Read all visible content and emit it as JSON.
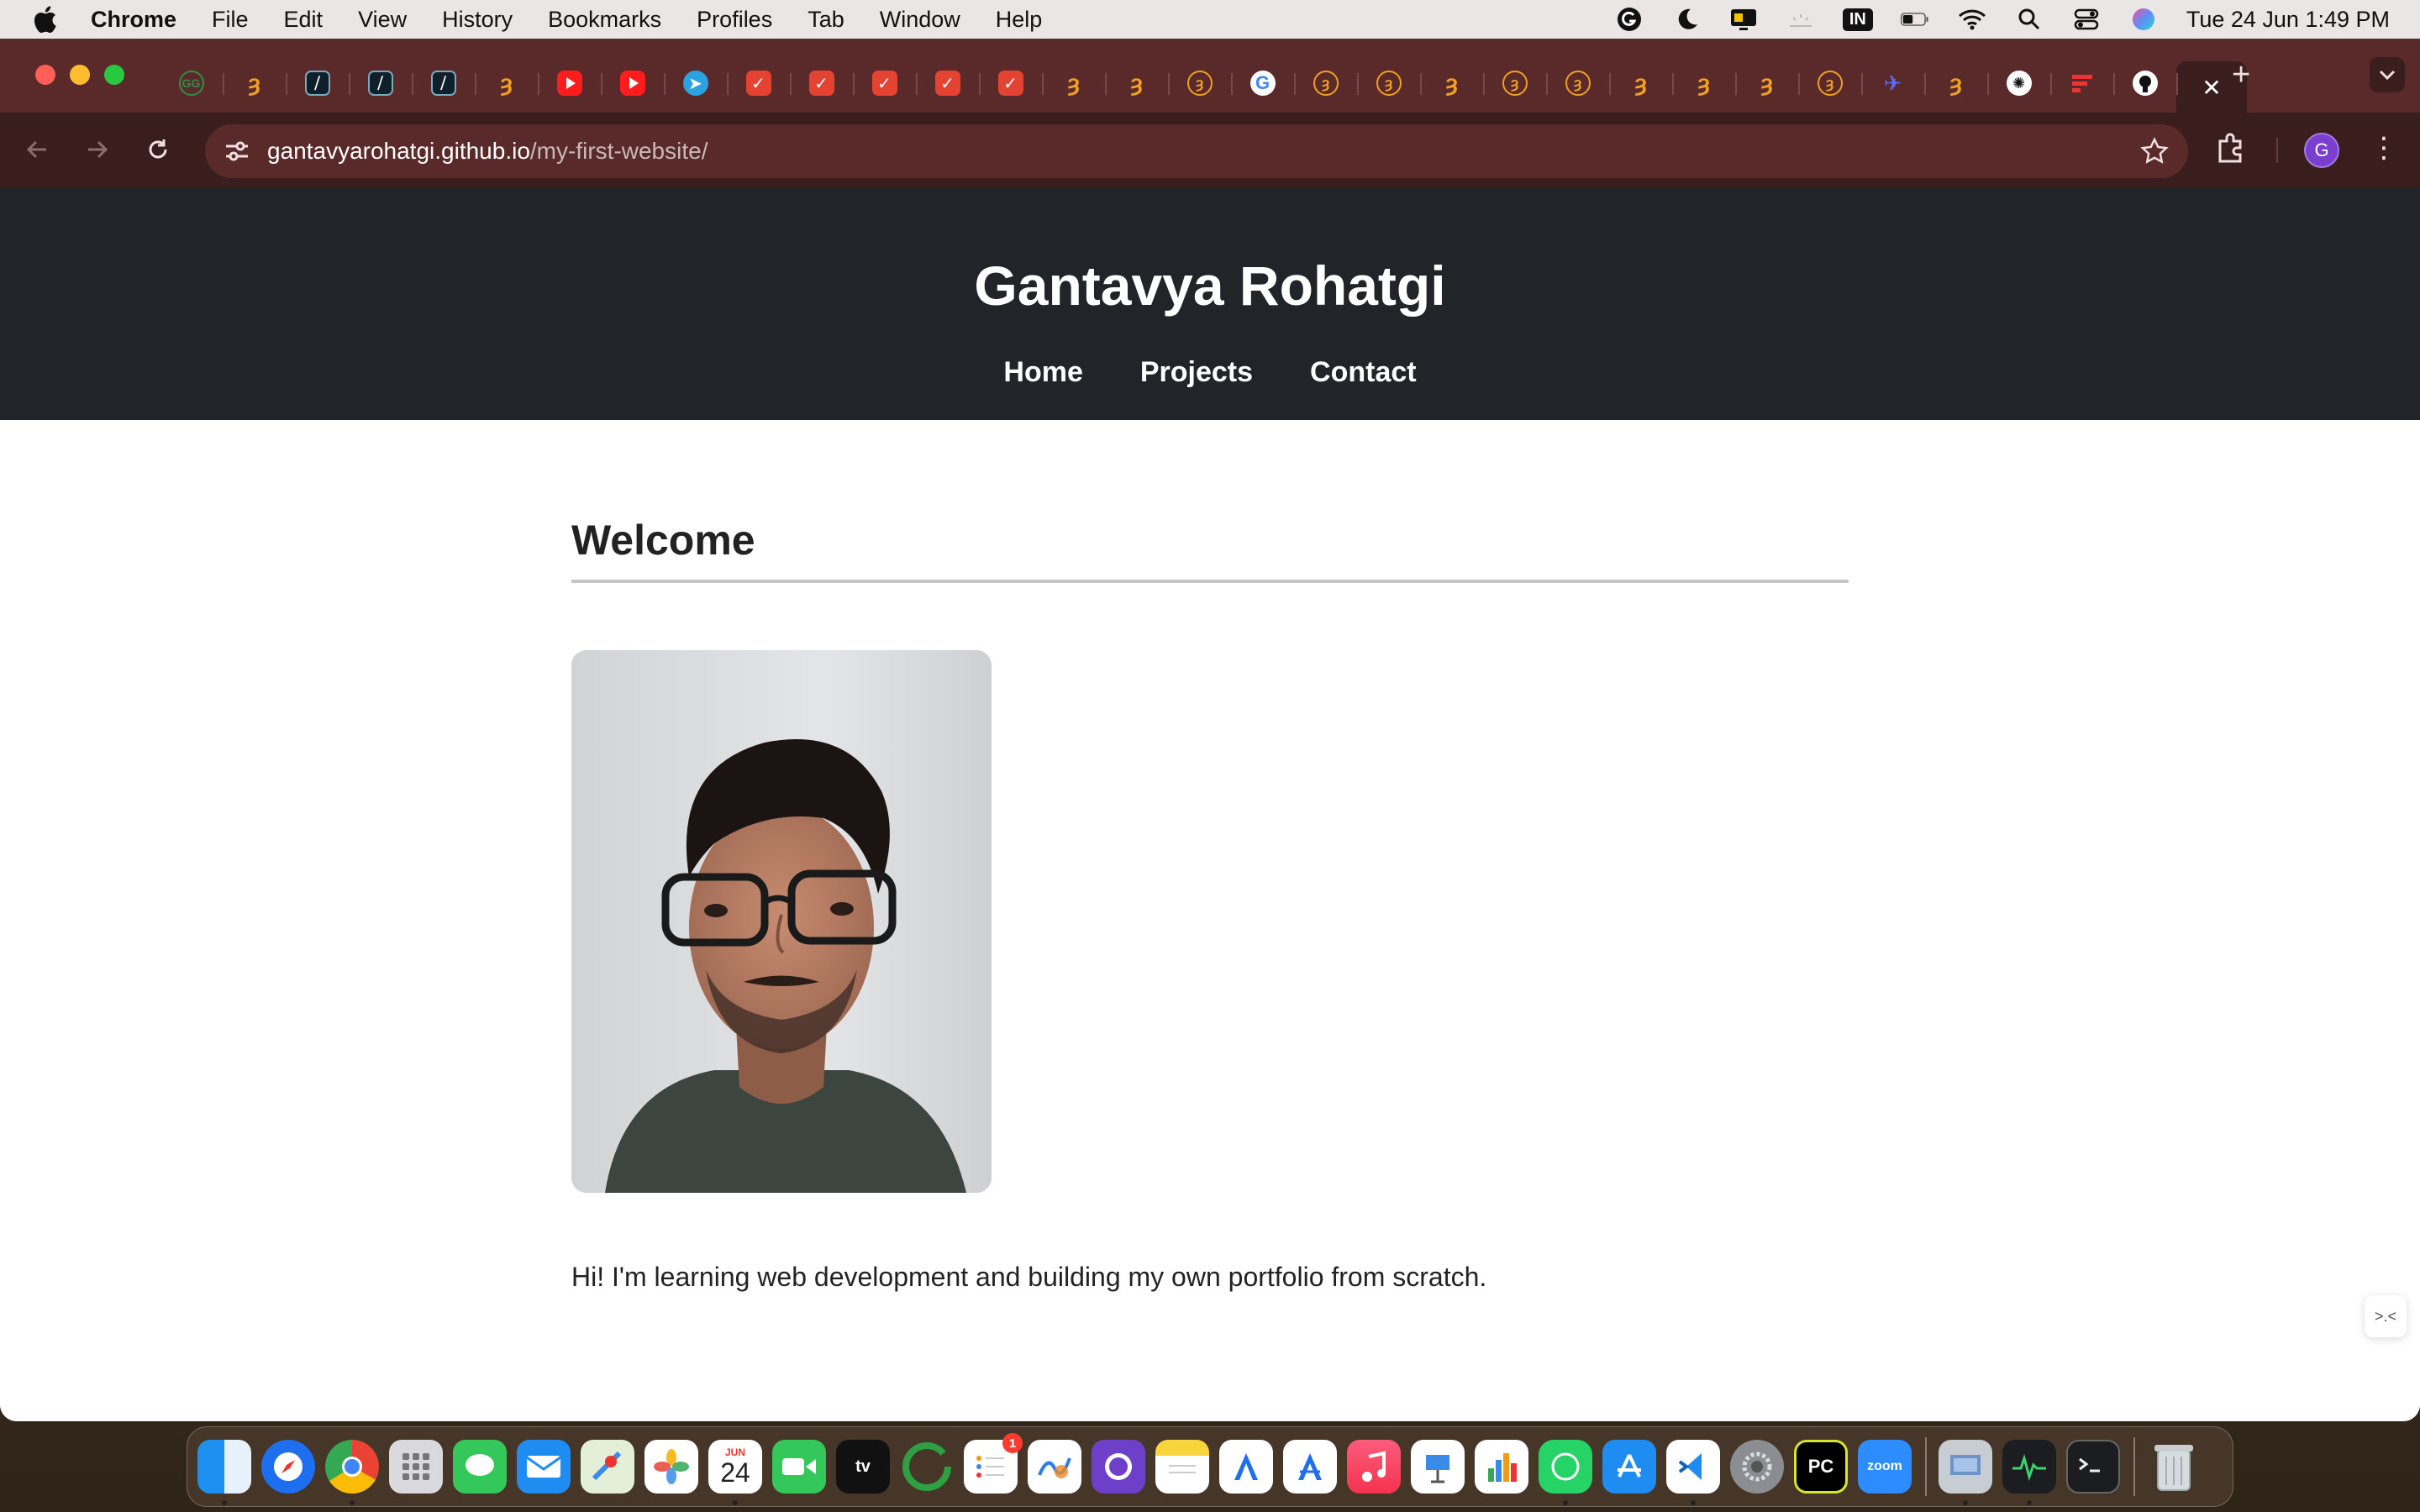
{
  "menubar": {
    "app_name": "Chrome",
    "items": [
      "File",
      "Edit",
      "View",
      "History",
      "Bookmarks",
      "Profiles",
      "Tab",
      "Window",
      "Help"
    ],
    "input_source": "IN",
    "clock": "Tue 24 Jun  1:49 PM"
  },
  "browser": {
    "tabs": [
      {
        "icon": "gfg-icon"
      },
      {
        "icon": "codeforces-icon"
      },
      {
        "icon": "slash-icon"
      },
      {
        "icon": "slash-icon"
      },
      {
        "icon": "slash-icon"
      },
      {
        "icon": "codeforces-icon"
      },
      {
        "icon": "youtube-icon"
      },
      {
        "icon": "youtube-icon"
      },
      {
        "icon": "telegram-icon"
      },
      {
        "icon": "todoist-icon"
      },
      {
        "icon": "todoist-icon"
      },
      {
        "icon": "todoist-icon"
      },
      {
        "icon": "todoist-icon"
      },
      {
        "icon": "todoist-icon"
      },
      {
        "icon": "codeforces-icon"
      },
      {
        "icon": "codeforces-icon"
      },
      {
        "icon": "leetcode-icon"
      },
      {
        "icon": "google-icon"
      },
      {
        "icon": "leetcode-icon"
      },
      {
        "icon": "leetcode-icon"
      },
      {
        "icon": "codeforces-icon"
      },
      {
        "icon": "leetcode-icon"
      },
      {
        "icon": "leetcode-icon"
      },
      {
        "icon": "codeforces-icon"
      },
      {
        "icon": "codeforces-icon"
      },
      {
        "icon": "codeforces-icon"
      },
      {
        "icon": "leetcode-icon"
      },
      {
        "icon": "bird-icon"
      },
      {
        "icon": "codeforces-icon"
      },
      {
        "icon": "chatgpt-icon"
      },
      {
        "icon": "bar-chart-icon"
      },
      {
        "icon": "github-icon"
      }
    ],
    "url_host": "gantavyarohatgi.github.io",
    "url_path": "/my-first-website/",
    "profile_initial": "G"
  },
  "site": {
    "title": "Gantavya Rohatgi",
    "nav": [
      "Home",
      "Projects",
      "Contact"
    ],
    "section_title": "Welcome",
    "intro": "Hi! I'm learning web development and building my own portfolio from scratch."
  },
  "side_widget": ">.<",
  "dock": {
    "calendar_month": "JUN",
    "calendar_day": "24",
    "reminders_badge": "1",
    "zoom_label": "zoom",
    "pycharm_label": "PC"
  },
  "colors": {
    "header_bg": "#212529",
    "tabstrip": "#5a2a2a",
    "toolbar": "#3a1d1d"
  }
}
